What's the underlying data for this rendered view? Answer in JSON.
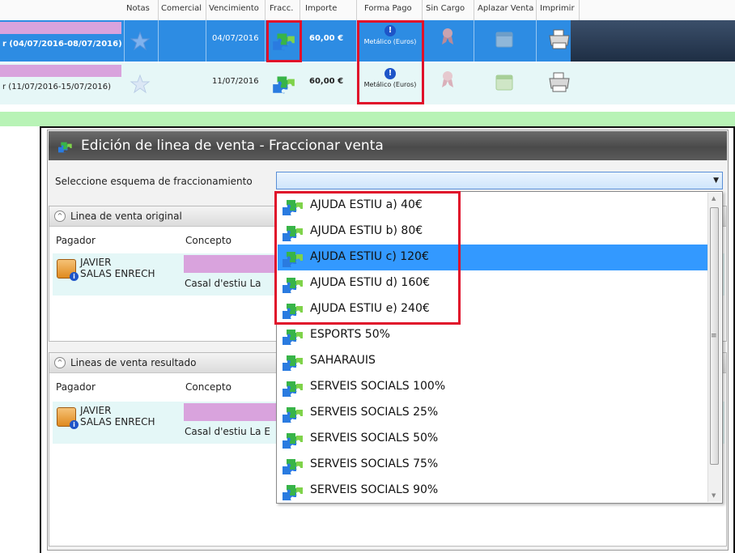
{
  "grid": {
    "columns": [
      "Notas",
      "Comercial",
      "Vencimiento",
      "Fracc.",
      "Importe",
      "Forma Pago",
      "Sin Cargo",
      "Aplazar Venta",
      "Imprimir"
    ],
    "rows": [
      {
        "range": "r (04/07/2016-08/07/2016)",
        "due": "04/07/2016",
        "amount": "60,00 €",
        "payment": "Metálico (Euros)"
      },
      {
        "range": "r (11/07/2016-15/07/2016)",
        "due": "11/07/2016",
        "amount": "60,00 €",
        "payment": "Metálico (Euros)"
      }
    ]
  },
  "dialog": {
    "title": "Edición de linea de venta - Fraccionar venta",
    "scheme_label": "Seleccione esquema de fraccionamiento",
    "scheme_value": "",
    "original": {
      "title": "Linea de venta original",
      "col_payer": "Pagador",
      "col_concept": "Concepto",
      "payer_first": "JAVIER",
      "payer_last": "SALAS  ENRECH",
      "concept": "Casal d'estiu La"
    },
    "result": {
      "title": "Lineas de venta resultado",
      "col_payer": "Pagador",
      "col_concept": "Concepto",
      "payer_first": "JAVIER",
      "payer_last": "SALAS  ENRECH",
      "concept": "Casal d'estiu La E"
    }
  },
  "dropdown": {
    "selected_index": 2,
    "items": [
      "AJUDA ESTIU a) 40€",
      "AJUDA ESTIU b) 80€",
      "AJUDA ESTIU c) 120€",
      "AJUDA ESTIU d) 160€",
      "AJUDA ESTIU e) 240€",
      "ESPORTS 50%",
      "SAHARAUIS",
      "SERVEIS SOCIALS 100%",
      "SERVEIS SOCIALS 25%",
      "SERVEIS SOCIALS 50%",
      "SERVEIS SOCIALS 75%",
      "SERVEIS SOCIALS 90%"
    ]
  },
  "colors": {
    "selected_row": "#2d8ce3",
    "highlight": "#e0102a",
    "selection": "#3399ff"
  }
}
